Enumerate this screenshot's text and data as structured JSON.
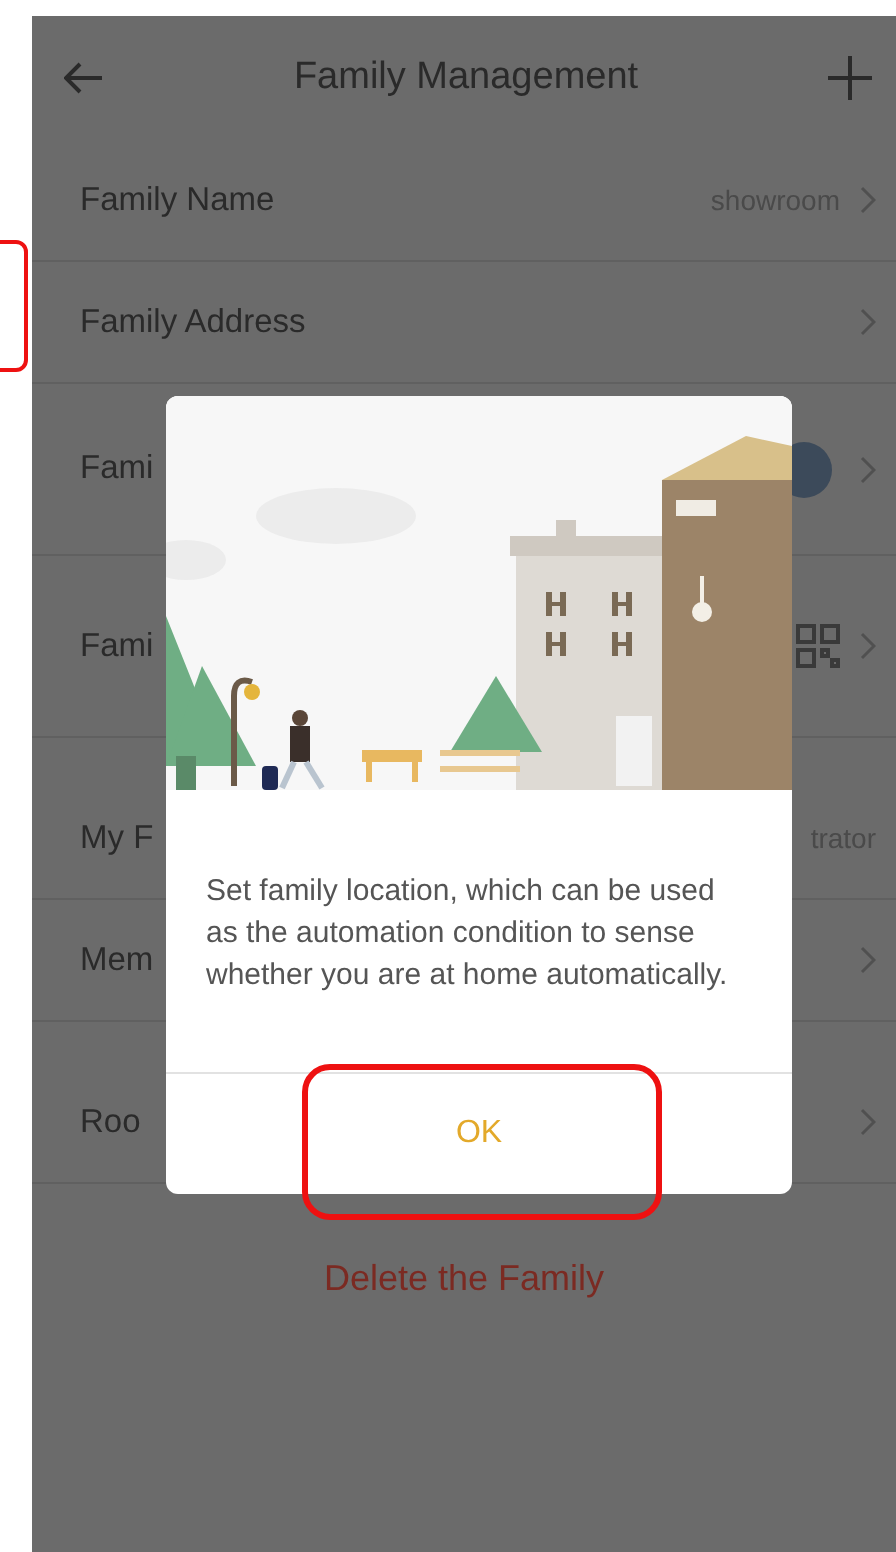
{
  "header": {
    "title": "Family Management"
  },
  "rows": [
    {
      "kind": "value",
      "label": "Family Name",
      "value": "showroom",
      "chevron": true,
      "gap_before": false
    },
    {
      "kind": "plain",
      "label": "Family Address",
      "chevron": true,
      "gap_before": false
    },
    {
      "kind": "avatar",
      "label": "Fami",
      "chevron": true,
      "gap_before": false
    },
    {
      "kind": "qr",
      "label": "Fami",
      "chevron": true,
      "gap_before": false
    },
    {
      "kind": "value",
      "label": "My F",
      "value": "trator",
      "chevron": false,
      "gap_before": true
    },
    {
      "kind": "plain",
      "label": "Mem",
      "chevron": true,
      "gap_before": false
    },
    {
      "kind": "plain",
      "label": "Roo",
      "chevron": true,
      "gap_before": true
    }
  ],
  "delete_button": "Delete the Family",
  "dialog": {
    "message": "Set family location, which can be used as the automation condition to sense whether you are at home automatically.",
    "ok": "OK",
    "ok_highlighted": true
  },
  "annotation": {
    "left_frame": true
  }
}
